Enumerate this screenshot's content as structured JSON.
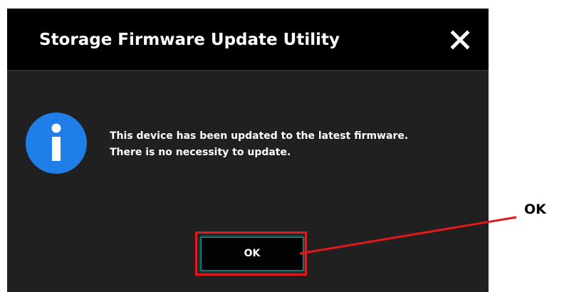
{
  "dialog": {
    "title": "Storage Firmware Update Utility",
    "close_icon": "close-icon",
    "info_icon": "info-icon",
    "message": [
      "This device has been updated to the latest firmware.",
      "There is no necessity to update."
    ],
    "ok_label": "OK"
  },
  "annotation": {
    "label": "OK",
    "color": "#e11919"
  },
  "colors": {
    "title_bar": "#000000",
    "dialog_body": "#202020",
    "info_icon": "#1f7ee8",
    "button_accent": "#0a8f92"
  }
}
